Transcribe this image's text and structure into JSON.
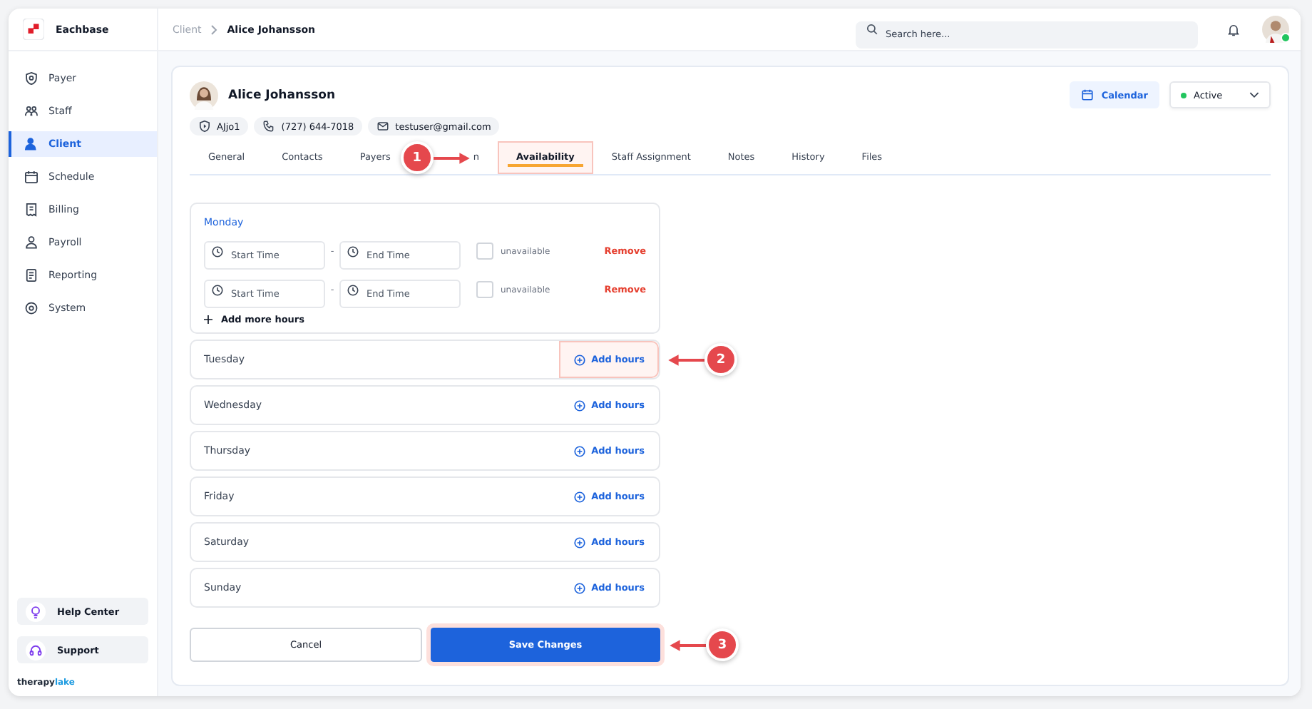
{
  "brand": {
    "name": "Eachbase"
  },
  "sidebar": {
    "items": [
      {
        "label": "Payer",
        "selected": false
      },
      {
        "label": "Staff",
        "selected": false
      },
      {
        "label": "Client",
        "selected": true
      },
      {
        "label": "Schedule",
        "selected": false
      },
      {
        "label": "Billing",
        "selected": false
      },
      {
        "label": "Payroll",
        "selected": false
      },
      {
        "label": "Reporting",
        "selected": false
      },
      {
        "label": "System",
        "selected": false
      }
    ],
    "footer_buttons": [
      {
        "label": "Help Center"
      },
      {
        "label": "Support"
      }
    ],
    "footer_logo": {
      "first": "therapy",
      "second": "lake"
    }
  },
  "breadcrumb": [
    "Client",
    "Alice Johansson"
  ],
  "search": {
    "placeholder": "Search here..."
  },
  "user": {
    "online": true
  },
  "client": {
    "name": "Alice Johansson",
    "id": "AJjo1",
    "phone": "(727) 644-7018",
    "email": "testuser@gmail.com"
  },
  "calendar_button": "Calendar",
  "status": {
    "label": "Active",
    "color": "#22c55e"
  },
  "tabs": [
    {
      "label": "General",
      "selected": false,
      "highlighted": false
    },
    {
      "label": "Contacts",
      "selected": false,
      "highlighted": false
    },
    {
      "label": "Payers",
      "selected": false,
      "highlighted": false
    },
    {
      "label": "n",
      "selected": false,
      "highlighted": false,
      "callout": "1"
    },
    {
      "label": "Availability",
      "selected": true,
      "highlighted": true
    },
    {
      "label": "Staff Assignment",
      "selected": false,
      "highlighted": false
    },
    {
      "label": "Notes",
      "selected": false,
      "highlighted": false
    },
    {
      "label": "History",
      "selected": false,
      "highlighted": false
    },
    {
      "label": "Files",
      "selected": false,
      "highlighted": false
    }
  ],
  "days": [
    {
      "name": "Monday",
      "expanded": true,
      "slots": [
        {
          "start": {
            "placeholder": "Start Time"
          },
          "end": {
            "placeholder": "End Time"
          },
          "separator": "-",
          "unavailable": false,
          "unavailable_label": "unavailable",
          "remove": "Remove"
        },
        {
          "start": {
            "placeholder": "Start Time"
          },
          "end": {
            "placeholder": "End Time"
          },
          "separator": "-",
          "unavailable": false,
          "unavailable_label": "unavailable",
          "remove": "Remove"
        }
      ],
      "add_more": "Add more hours"
    },
    {
      "name": "Tuesday",
      "expanded": false,
      "add": "Add hours",
      "highlighted": true,
      "callout": "2"
    },
    {
      "name": "Wednesday",
      "expanded": false,
      "add": "Add hours",
      "highlighted": false
    },
    {
      "name": "Thursday",
      "expanded": false,
      "add": "Add hours",
      "highlighted": false
    },
    {
      "name": "Friday",
      "expanded": false,
      "add": "Add hours",
      "highlighted": false
    },
    {
      "name": "Saturday",
      "expanded": false,
      "add": "Add hours",
      "highlighted": false
    },
    {
      "name": "Sunday",
      "expanded": false,
      "add": "Add hours",
      "highlighted": false
    }
  ],
  "actions": {
    "cancel": "Cancel",
    "save": "Save Changes",
    "save_highlighted": true,
    "save_callout": "3"
  }
}
